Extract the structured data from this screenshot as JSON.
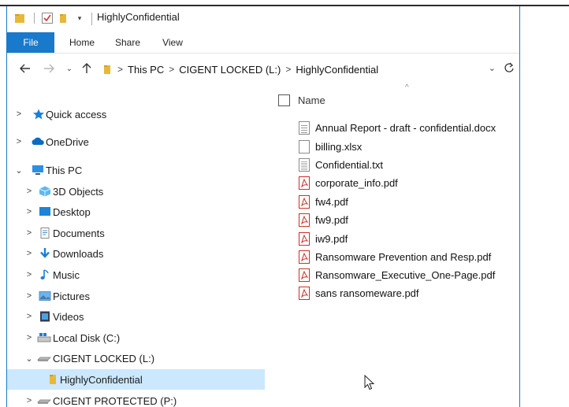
{
  "window": {
    "title": "HighlyConfidential",
    "accent_color": "#1979ca"
  },
  "title_bar": {
    "icons": [
      "folder-icon",
      "properties-checkmark-icon",
      "new-folder-icon",
      "customize-dropdown-icon"
    ]
  },
  "ribbon": {
    "tabs": [
      {
        "label": "File",
        "active": true
      },
      {
        "label": "Home"
      },
      {
        "label": "Share"
      },
      {
        "label": "View"
      }
    ]
  },
  "address_bar": {
    "crumbs": [
      "This PC",
      "CIGENT LOCKED (L:)",
      "HighlyConfidential"
    ],
    "icons": [
      "back-arrow-icon",
      "forward-arrow-icon",
      "recent-dropdown-icon",
      "up-arrow-icon",
      "folder-icon",
      "refresh-icon"
    ]
  },
  "nav_pane": {
    "items": [
      {
        "label": "Quick access",
        "icon": "star-icon",
        "expanded": false
      },
      {
        "label": "OneDrive",
        "icon": "cloud-icon",
        "expanded": false
      },
      {
        "label": "This PC",
        "icon": "computer-icon",
        "expanded": true
      },
      {
        "label": "3D Objects",
        "icon": "cube-icon",
        "expanded": false
      },
      {
        "label": "Desktop",
        "icon": "desktop-icon",
        "expanded": false
      },
      {
        "label": "Documents",
        "icon": "documents-icon",
        "expanded": false
      },
      {
        "label": "Downloads",
        "icon": "download-icon",
        "expanded": false
      },
      {
        "label": "Music",
        "icon": "music-note-icon",
        "expanded": false
      },
      {
        "label": "Pictures",
        "icon": "pictures-icon",
        "expanded": false
      },
      {
        "label": "Videos",
        "icon": "video-icon",
        "expanded": false
      },
      {
        "label": "Local Disk (C:)",
        "icon": "drive-icon",
        "expanded": false
      },
      {
        "label": "CIGENT LOCKED (L:)",
        "icon": "drive-icon",
        "expanded": true
      },
      {
        "label": "HighlyConfidential",
        "icon": "folder-icon",
        "selected": true
      },
      {
        "label": "CIGENT PROTECTED (P:)",
        "icon": "drive-icon",
        "expanded": false
      }
    ]
  },
  "file_list": {
    "column_name": "Name",
    "files": [
      {
        "name": "Annual Report - draft - confidential.docx",
        "type": "doc"
      },
      {
        "name": "billing.xlsx",
        "type": "blank"
      },
      {
        "name": "Confidential.txt",
        "type": "txt"
      },
      {
        "name": "corporate_info.pdf",
        "type": "pdf"
      },
      {
        "name": "fw4.pdf",
        "type": "pdf"
      },
      {
        "name": "fw9.pdf",
        "type": "pdf"
      },
      {
        "name": "iw9.pdf",
        "type": "pdf"
      },
      {
        "name": "Ransomware Prevention and Resp.pdf",
        "type": "pdf"
      },
      {
        "name": "Ransomware_Executive_One-Page.pdf",
        "type": "pdf"
      },
      {
        "name": "sans ransomeware.pdf",
        "type": "pdf"
      }
    ]
  }
}
